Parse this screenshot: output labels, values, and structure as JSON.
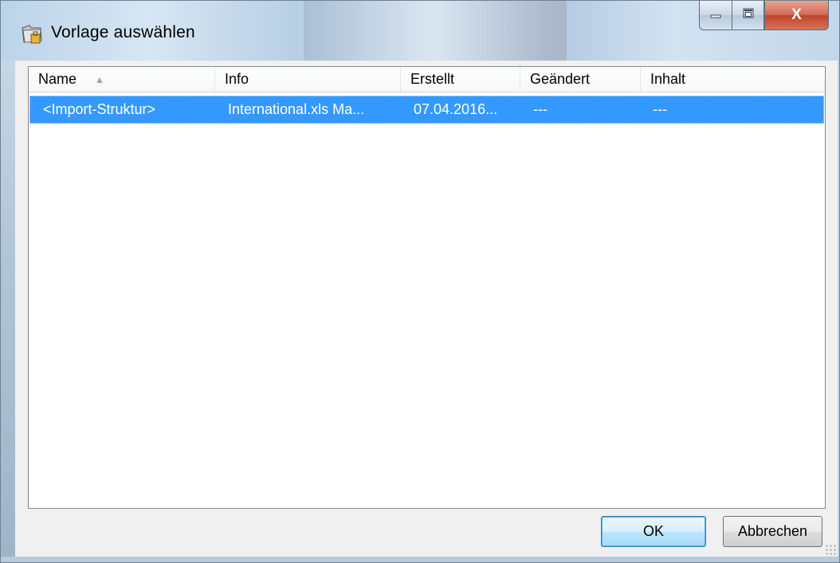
{
  "window": {
    "title": "Vorlage auswählen",
    "icon": "template-folder-icon"
  },
  "caption_buttons": {
    "minimize": "—",
    "maximize": "□",
    "close": "X"
  },
  "listview": {
    "columns": [
      "Name",
      "Info",
      "Erstellt",
      "Geändert",
      "Inhalt"
    ],
    "sort_column": "Name",
    "sort_direction": "ascending",
    "rows": [
      {
        "name": "<Import-Struktur>",
        "info": "International.xls Ma...",
        "erstellt": "07.04.2016...",
        "geaendert": "---",
        "inhalt": "---",
        "selected": true
      }
    ]
  },
  "buttons": {
    "ok": "OK",
    "cancel": "Abbrechen"
  },
  "colors": {
    "selection": "#3399ff",
    "close_button": "#c7503a"
  }
}
